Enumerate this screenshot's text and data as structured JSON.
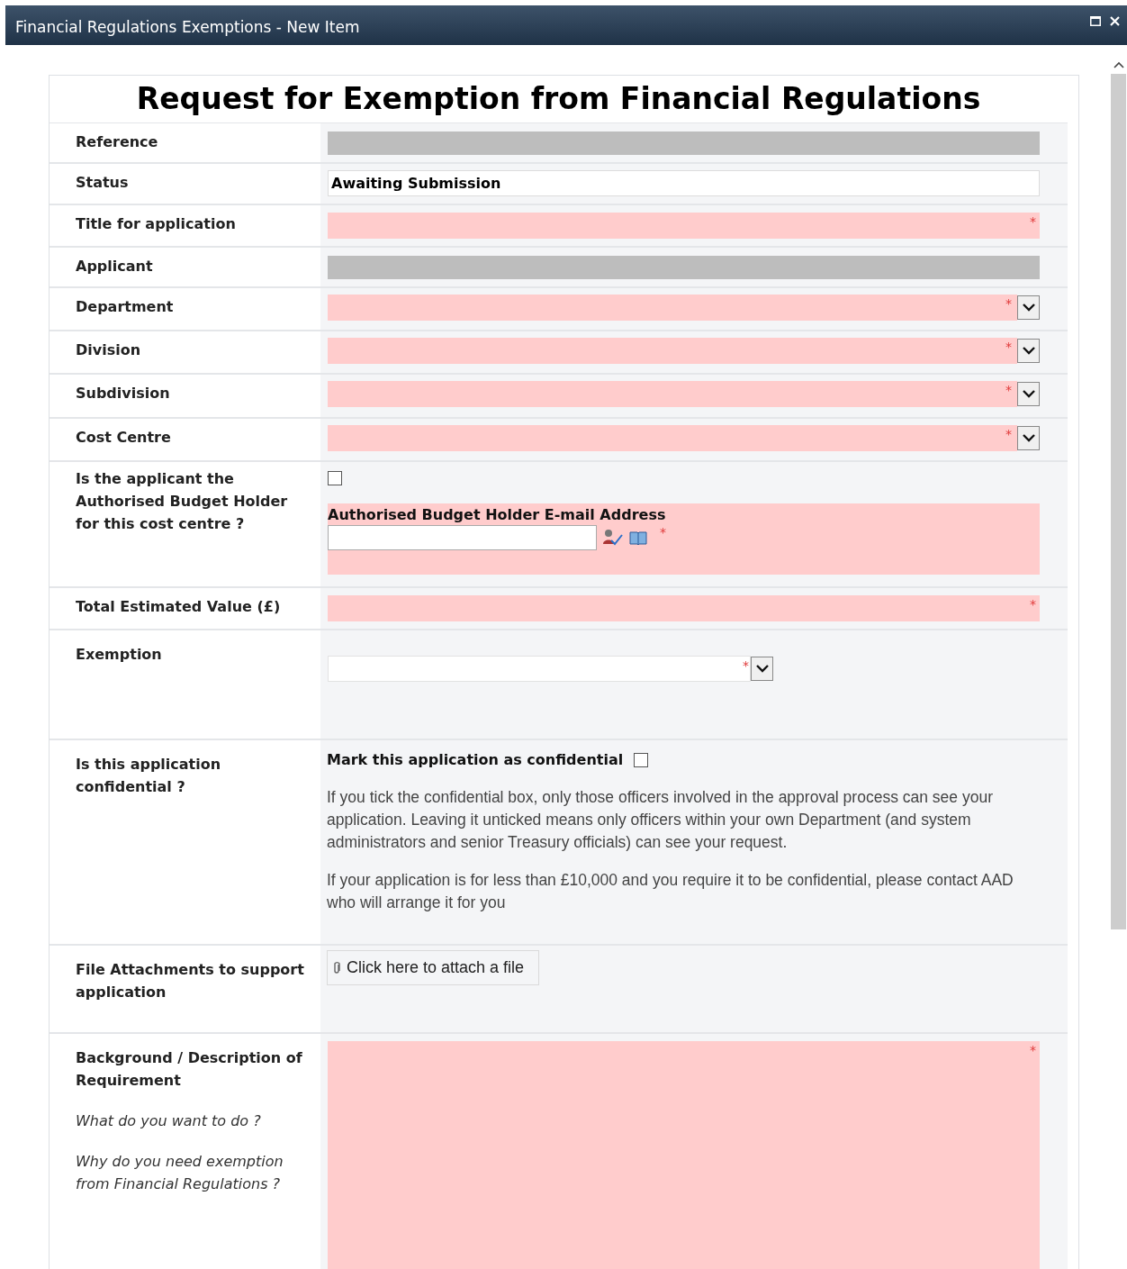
{
  "window": {
    "title": "Financial Regulations Exemptions - New Item"
  },
  "form": {
    "heading": "Request for Exemption from Financial Regulations",
    "rows": [
      {
        "label": "Reference",
        "kind": "readonly"
      },
      {
        "label": "Status",
        "kind": "text",
        "value": "Awaiting Submission"
      },
      {
        "label": "Title for application",
        "kind": "required_text",
        "required_mark": "*"
      },
      {
        "label": "Applicant",
        "kind": "readonly"
      },
      {
        "label": "Department",
        "kind": "dropdown",
        "required_mark": "*"
      },
      {
        "label": "Division",
        "kind": "dropdown",
        "required_mark": "*"
      },
      {
        "label": "Subdivision",
        "kind": "dropdown",
        "required_mark": "*"
      },
      {
        "label": "Cost Centre",
        "kind": "dropdown",
        "required_mark": "*"
      },
      {
        "label": "Is the applicant the Authorised Budget Holder for this cost centre ?",
        "kind": "budget_holder",
        "checked": false,
        "field_label": "Authorised Budget Holder E-mail Address",
        "required_mark": "*"
      },
      {
        "label": "Total Estimated Value (£)",
        "kind": "required_text",
        "required_mark": "*"
      },
      {
        "label": "Exemption",
        "kind": "select",
        "required_mark": "*"
      },
      {
        "label": "Is this application confidential ?",
        "kind": "confidential",
        "checkbox_label": "Mark this application as confidential",
        "checked": false,
        "paragraphs": [
          "If you tick the confidential box, only those officers involved in the approval process can see your application. Leaving it unticked means only officers within your own Department (and system administrators and senior Treasury officials) can see your request.",
          "If your application is for less than £10,000 and you require it to be confidential, please contact AAD who will arrange it for you"
        ]
      },
      {
        "label": "File Attachments to support application",
        "kind": "attach",
        "link": "Click here to attach a file"
      },
      {
        "label": "Background / Description of Requirement",
        "kind": "textarea",
        "required_mark": "*",
        "hints": [
          "What do you want to do ?",
          "Why do you need exemption from Financial Regulations ?"
        ]
      }
    ]
  }
}
